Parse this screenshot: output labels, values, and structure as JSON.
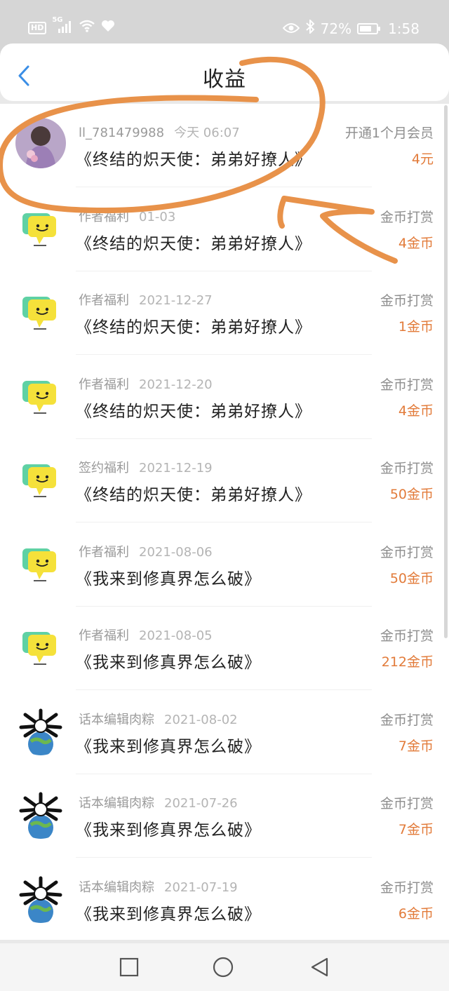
{
  "status_bar": {
    "hd": "HD",
    "network": "5G",
    "battery_percent": "72%",
    "battery_level": 0.72,
    "time": "1:58"
  },
  "header": {
    "title": "收益"
  },
  "rows": [
    {
      "avatar": "photo-girl-avatar",
      "name": "ll_781479988",
      "date": "今天 06:07",
      "book": "《终结的炽天使：弟弟好撩人》",
      "type": "开通1个月会员",
      "amount": "4元"
    },
    {
      "avatar": "speech-bubble-avatar",
      "name": "作者福利",
      "date": "01-03",
      "book": "《终结的炽天使：弟弟好撩人》",
      "type": "金币打赏",
      "amount": "4金币"
    },
    {
      "avatar": "speech-bubble-avatar",
      "name": "作者福利",
      "date": "2021-12-27",
      "book": "《终结的炽天使：弟弟好撩人》",
      "type": "金币打赏",
      "amount": "1金币"
    },
    {
      "avatar": "speech-bubble-avatar",
      "name": "作者福利",
      "date": "2021-12-20",
      "book": "《终结的炽天使：弟弟好撩人》",
      "type": "金币打赏",
      "amount": "4金币"
    },
    {
      "avatar": "speech-bubble-avatar",
      "name": "签约福利",
      "date": "2021-12-19",
      "book": "《终结的炽天使：弟弟好撩人》",
      "type": "金币打赏",
      "amount": "50金币"
    },
    {
      "avatar": "speech-bubble-avatar",
      "name": "作者福利",
      "date": "2021-08-06",
      "book": "《我来到修真界怎么破》",
      "type": "金币打赏",
      "amount": "50金币"
    },
    {
      "avatar": "speech-bubble-avatar",
      "name": "作者福利",
      "date": "2021-08-05",
      "book": "《我来到修真界怎么破》",
      "type": "金币打赏",
      "amount": "212金币"
    },
    {
      "avatar": "globe-figure-avatar",
      "name": "话本编辑肉粽",
      "date": "2021-08-02",
      "book": "《我来到修真界怎么破》",
      "type": "金币打赏",
      "amount": "7金币"
    },
    {
      "avatar": "globe-figure-avatar",
      "name": "话本编辑肉粽",
      "date": "2021-07-26",
      "book": "《我来到修真界怎么破》",
      "type": "金币打赏",
      "amount": "7金币"
    },
    {
      "avatar": "globe-figure-avatar",
      "name": "话本编辑肉粽",
      "date": "2021-07-19",
      "book": "《我来到修真界怎么破》",
      "type": "金币打赏",
      "amount": "6金币"
    }
  ],
  "colors": {
    "accent": "#e27b3a",
    "back_arrow": "#3a8ee6",
    "annotation": "#e8924a"
  }
}
